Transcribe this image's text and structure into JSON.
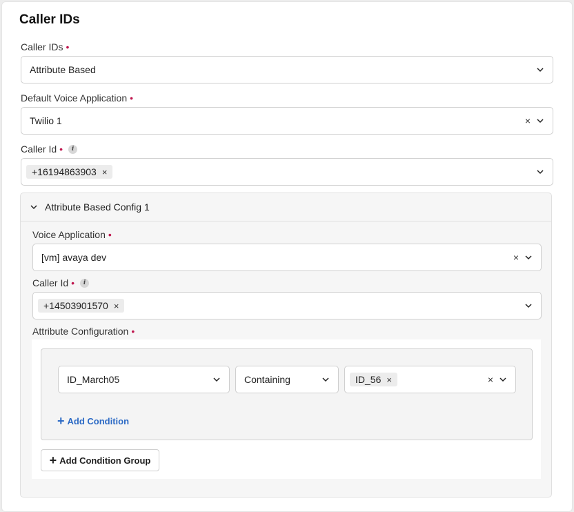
{
  "page": {
    "title": "Caller IDs"
  },
  "caller_ids": {
    "label": "Caller IDs",
    "value": "Attribute Based"
  },
  "default_voice_app": {
    "label": "Default Voice Application",
    "value": "Twilio 1"
  },
  "caller_id": {
    "label": "Caller Id",
    "chips": [
      "+16194863903"
    ]
  },
  "config_section": {
    "title": "Attribute Based Config 1",
    "voice_app": {
      "label": "Voice Application",
      "value": "[vm] avaya dev"
    },
    "caller_id": {
      "label": "Caller Id",
      "chips": [
        "+14503901570"
      ]
    },
    "attribute_config": {
      "label": "Attribute Configuration",
      "condition": {
        "attribute": "ID_March05",
        "operator": "Containing",
        "values": [
          "ID_56"
        ]
      },
      "add_condition_label": "Add Condition",
      "add_group_label": "Add Condition Group"
    }
  },
  "icons": {
    "required": "•",
    "info": "i",
    "clear": "×",
    "chip_remove": "×",
    "plus": "+"
  },
  "colors": {
    "required": "#c0184f",
    "link": "#2c6ac5"
  }
}
